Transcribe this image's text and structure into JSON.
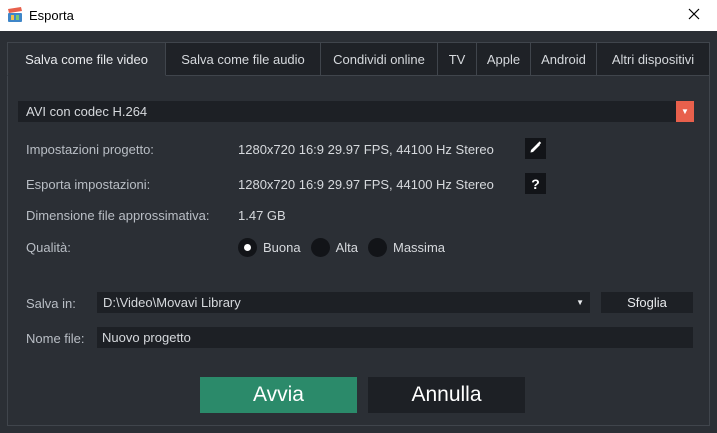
{
  "window": {
    "title": "Esporta",
    "app_icon": "movavi-clapper-icon",
    "close_icon": "close-icon"
  },
  "colors": {
    "background": "#2b2f35",
    "field": "#1d2025",
    "accent_orange": "#e8604c",
    "accent_green": "#2b8a6a"
  },
  "tabs": [
    {
      "label": "Salva come file video",
      "active": true
    },
    {
      "label": "Salva come file audio",
      "active": false
    },
    {
      "label": "Condividi online",
      "active": false
    },
    {
      "label": "TV",
      "active": false
    },
    {
      "label": "Apple",
      "active": false
    },
    {
      "label": "Android",
      "active": false
    },
    {
      "label": "Altri dispositivi",
      "active": false
    }
  ],
  "format": {
    "selected": "AVI con codec H.264",
    "arrow_icon": "dropdown-arrow-icon"
  },
  "settings": {
    "project_label": "Impostazioni progetto:",
    "project_value": "1280x720 16:9 29.97 FPS, 44100 Hz Stereo",
    "project_icon": "pencil-icon",
    "export_label": "Esporta impostazioni:",
    "export_value": "1280x720 16:9 29.97 FPS, 44100 Hz Stereo",
    "export_icon": "help-icon",
    "help_glyph": "?",
    "size_label": "Dimensione file approssimativa:",
    "size_value": "1.47 GB"
  },
  "quality": {
    "label": "Qualità:",
    "options": [
      {
        "label": "Buona",
        "selected": true
      },
      {
        "label": "Alta",
        "selected": false
      },
      {
        "label": "Massima",
        "selected": false
      }
    ]
  },
  "save": {
    "label": "Salva in:",
    "path": "D:\\Video\\Movavi Library",
    "browse_label": "Sfoglia"
  },
  "filename": {
    "label": "Nome file:",
    "value": "Nuovo progetto"
  },
  "actions": {
    "start_label": "Avvia",
    "cancel_label": "Annulla"
  }
}
